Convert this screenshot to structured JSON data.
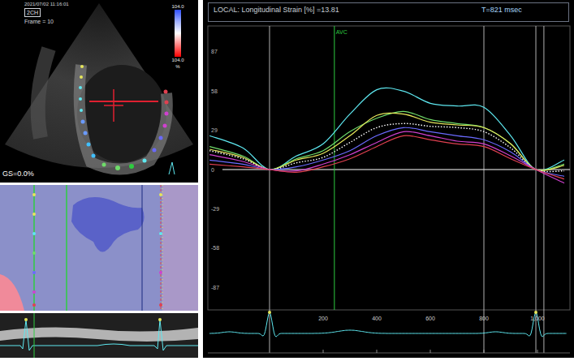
{
  "ultrasound": {
    "timestamp": "2021/07/02 11:16:01",
    "view": "2CH",
    "frame": "Frame = 10",
    "scale_max": "104.0",
    "scale_min": "104.0",
    "scale_unit": "%",
    "global_strain": "GS=0.0%"
  },
  "header": {
    "measure": "LOCAL: Longitudinal Strain [%] =13.81",
    "time": "T=821 msec"
  },
  "chart": {
    "y_ticks": [
      {
        "label": "87",
        "v": 87
      },
      {
        "label": "58",
        "v": 58
      },
      {
        "label": "29",
        "v": 29
      },
      {
        "label": "0",
        "v": 0
      },
      {
        "label": "-29",
        "v": -29
      },
      {
        "label": "-58",
        "v": -58
      },
      {
        "label": "-87",
        "v": -87
      }
    ],
    "x_ticks": [
      {
        "label": "200",
        "t": 200
      },
      {
        "label": "400",
        "t": 400
      },
      {
        "label": "600",
        "t": 600
      },
      {
        "label": "800",
        "t": 800
      },
      {
        "label": "1,000",
        "t": 1000
      }
    ],
    "t": [
      -224,
      -100,
      0,
      100,
      200,
      300,
      400,
      500,
      600,
      700,
      800,
      900,
      994,
      1100
    ],
    "series": [
      {
        "kind": "solid",
        "color": "#5ee8f0",
        "values": [
          25,
          16,
          0,
          10,
          19,
          41,
          59,
          58,
          49,
          47,
          46,
          25,
          0,
          7
        ]
      },
      {
        "kind": "solid",
        "color": "#6fdc6a",
        "values": [
          17,
          10,
          0,
          8,
          14,
          28,
          38,
          43,
          37,
          34,
          31,
          19,
          0,
          4
        ]
      },
      {
        "kind": "solid",
        "color": "#e6e65a",
        "values": [
          15,
          9,
          0,
          7,
          12,
          25,
          40,
          41,
          35,
          33,
          31,
          19,
          0,
          3
        ]
      },
      {
        "kind": "dotted",
        "color": "#ffffff",
        "values": [
          14,
          8,
          0,
          5,
          9,
          20,
          31,
          34,
          32,
          31,
          28,
          16,
          0,
          -1
        ]
      },
      {
        "kind": "solid",
        "color": "#6a6aff",
        "values": [
          7,
          4,
          0,
          2,
          7,
          14,
          25,
          31,
          28,
          25,
          22,
          13,
          0,
          -5
        ]
      },
      {
        "kind": "solid",
        "color": "#d040d0",
        "values": [
          11,
          6,
          0,
          -1,
          4,
          11,
          20,
          28,
          25,
          21,
          19,
          10,
          0,
          -10
        ]
      },
      {
        "kind": "solid",
        "color": "#e04050",
        "values": [
          4,
          2,
          0,
          -2,
          2,
          8,
          17,
          25,
          22,
          19,
          17,
          8,
          0,
          -7
        ]
      }
    ],
    "markers": [
      {
        "label": "AVC",
        "t": 242,
        "color": "#2ecc40"
      }
    ],
    "lines": [
      0,
      800,
      994,
      1024
    ]
  }
}
